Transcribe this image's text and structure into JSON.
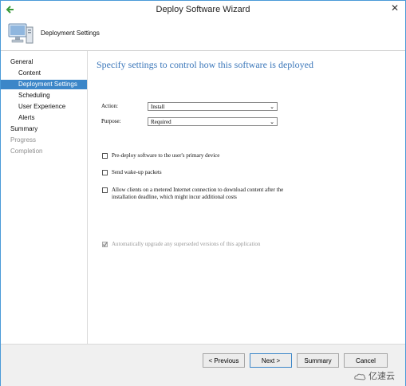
{
  "window": {
    "title": "Deploy Software Wizard",
    "close_glyph": "✕"
  },
  "header": {
    "title": "Deployment Settings"
  },
  "nav": {
    "items": [
      {
        "label": "General",
        "state": "normal"
      },
      {
        "label": "Content",
        "state": "normal"
      },
      {
        "label": "Deployment Settings",
        "state": "selected"
      },
      {
        "label": "Scheduling",
        "state": "normal"
      },
      {
        "label": "User Experience",
        "state": "normal"
      },
      {
        "label": "Alerts",
        "state": "normal"
      },
      {
        "label": "Summary",
        "state": "normal"
      },
      {
        "label": "Progress",
        "state": "disabled"
      },
      {
        "label": "Completion",
        "state": "disabled"
      }
    ]
  },
  "main": {
    "heading": "Specify settings to control how this software is deployed",
    "action": {
      "label": "Action:",
      "value": "Install"
    },
    "purpose": {
      "label": "Purpose:",
      "value": "Required"
    },
    "options": [
      {
        "text": "Pre-deploy software to the user's primary device",
        "checked": false,
        "enabled": true
      },
      {
        "text": "Send wake-up packets",
        "checked": false,
        "enabled": true
      },
      {
        "text": "Allow clients on a metered Internet connection to download content after the",
        "text2": "installation deadline, which might incur additional costs",
        "checked": false,
        "enabled": true
      },
      {
        "text": "Automatically upgrade any superseded versions of this application",
        "checked": true,
        "enabled": false
      }
    ]
  },
  "footer": {
    "previous": "< Previous",
    "next": "Next >",
    "summary": "Summary",
    "cancel": "Cancel"
  },
  "watermark": {
    "text": "亿速云"
  },
  "colors": {
    "accent": "#3c86c8",
    "heading": "#3a76b9",
    "border": "#4a9ad8"
  }
}
